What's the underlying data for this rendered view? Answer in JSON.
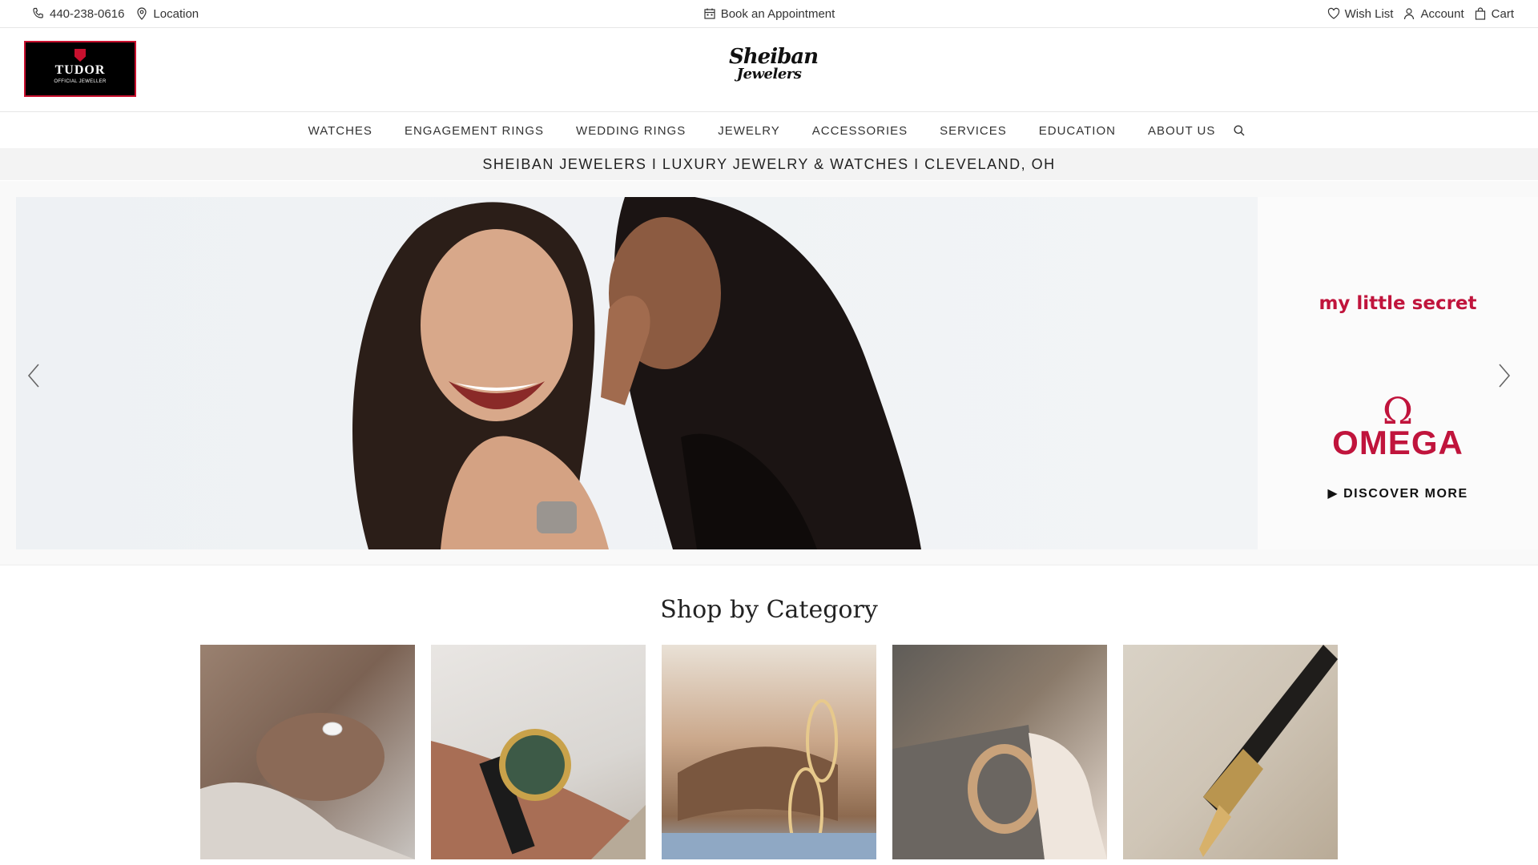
{
  "topbar": {
    "phone": "440-238-0616",
    "location": "Location",
    "appointment": "Book an Appointment",
    "wishlist": "Wish List",
    "account": "Account",
    "cart": "Cart"
  },
  "header": {
    "tudor_brand": "TUDOR",
    "tudor_sub": "OFFICIAL JEWELLER",
    "logo_line1": "Sheiban",
    "logo_line2": "Jewelers"
  },
  "nav": {
    "items": [
      "WATCHES",
      "ENGAGEMENT RINGS",
      "WEDDING RINGS",
      "JEWELRY",
      "ACCESSORIES",
      "SERVICES",
      "EDUCATION",
      "ABOUT US"
    ]
  },
  "tagline": "SHEIBAN JEWELERS I LUXURY JEWELRY & WATCHES I CLEVELAND, OH",
  "hero": {
    "secret": "my little secret",
    "omega_symbol": "Ω",
    "omega_word": "OMEGA",
    "discover": "▶ DISCOVER MORE"
  },
  "shop": {
    "title": "Shop by Category"
  },
  "colors": {
    "omega_red": "#c0143c",
    "tudor_red": "#c8102e",
    "tagline_bg": "#f3f3f3"
  }
}
